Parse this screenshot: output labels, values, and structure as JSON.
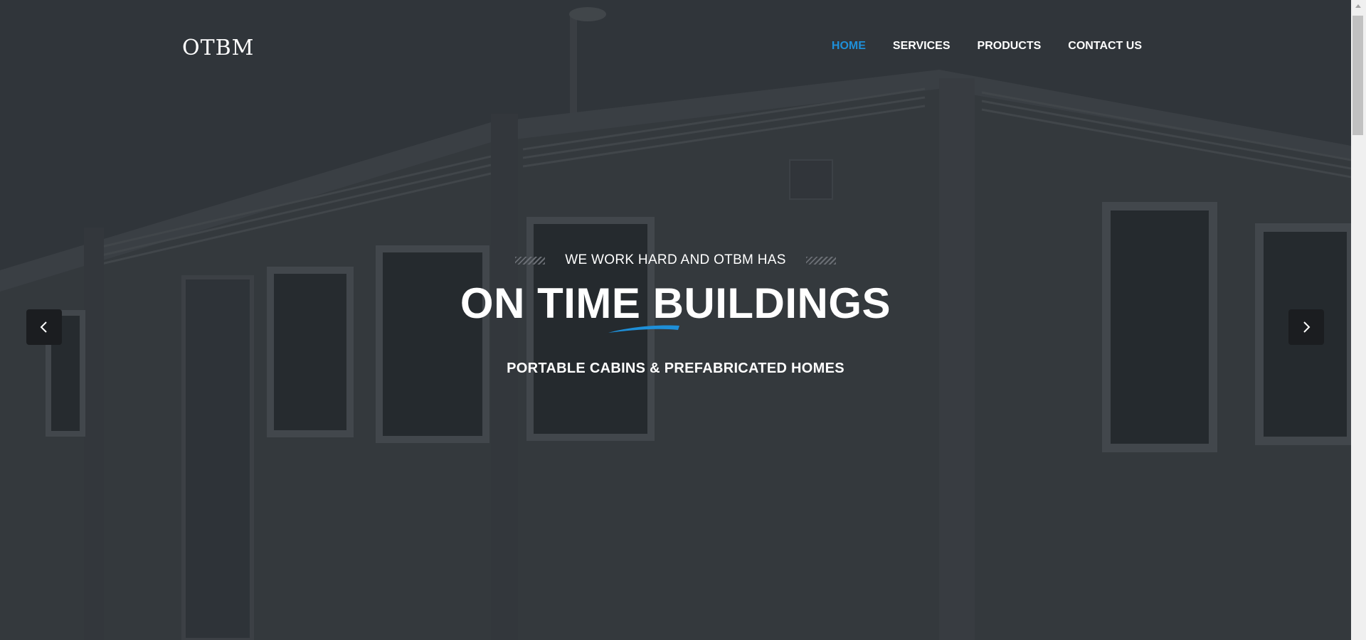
{
  "brand": {
    "logo": "OTBM"
  },
  "nav": {
    "items": [
      {
        "label": "HOME",
        "active": true
      },
      {
        "label": "SERVICES",
        "active": false
      },
      {
        "label": "PRODUCTS",
        "active": false
      },
      {
        "label": "CONTACT US",
        "active": false
      }
    ]
  },
  "hero": {
    "tagline": "WE WORK HARD AND OTBM HAS",
    "headline": "ON TIME BUILDINGS",
    "subline": "PORTABLE CABINS & PREFABRICATED HOMES",
    "prev_icon": "chevron-left-icon",
    "next_icon": "chevron-right-icon"
  },
  "colors": {
    "accent": "#1e8fd8",
    "overlay": "#2e3238",
    "arrow_bg": "#1b1d20"
  }
}
